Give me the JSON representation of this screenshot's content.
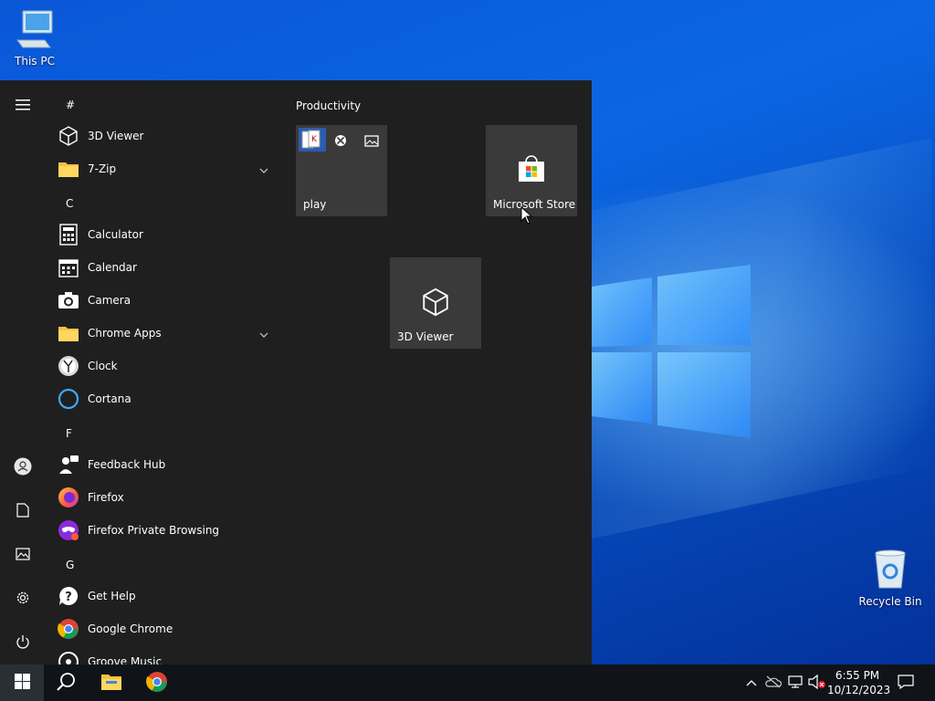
{
  "desktop": {
    "icons": [
      {
        "label": "This PC",
        "icon": "computer-icon"
      },
      {
        "label": "Recycle Bin",
        "icon": "recycle-bin-icon"
      }
    ]
  },
  "start_menu": {
    "rail": [
      "hamburger-menu-icon",
      "user-icon",
      "documents-icon",
      "pictures-icon",
      "settings-icon",
      "power-icon"
    ],
    "sections": [
      {
        "letter": "#",
        "apps": [
          {
            "label": "3D Viewer",
            "icon": "cube-icon"
          },
          {
            "label": "7-Zip",
            "icon": "folder-icon",
            "expandable": true
          }
        ]
      },
      {
        "letter": "C",
        "apps": [
          {
            "label": "Calculator",
            "icon": "calculator-icon"
          },
          {
            "label": "Calendar",
            "icon": "calendar-icon"
          },
          {
            "label": "Camera",
            "icon": "camera-icon"
          },
          {
            "label": "Chrome Apps",
            "icon": "folder-icon",
            "expandable": true
          },
          {
            "label": "Clock",
            "icon": "clock-icon"
          },
          {
            "label": "Cortana",
            "icon": "cortana-icon"
          }
        ]
      },
      {
        "letter": "F",
        "apps": [
          {
            "label": "Feedback Hub",
            "icon": "feedback-icon"
          },
          {
            "label": "Firefox",
            "icon": "firefox-icon"
          },
          {
            "label": "Firefox Private Browsing",
            "icon": "firefox-private-icon"
          }
        ]
      },
      {
        "letter": "G",
        "apps": [
          {
            "label": "Get Help",
            "icon": "help-icon"
          },
          {
            "label": "Google Chrome",
            "icon": "chrome-icon"
          },
          {
            "label": "Groove Music",
            "icon": "music-icon"
          }
        ]
      }
    ],
    "tiles": {
      "group_title": "Productivity",
      "play_label": "play",
      "store_label": "Microsoft Store",
      "viewer_label": "3D Viewer"
    }
  },
  "taskbar": {
    "start": "windows-start-icon",
    "search": "search-icon",
    "pinned": [
      "file-explorer-icon",
      "chrome-icon"
    ],
    "tray": [
      "chevron-up-icon",
      "onedrive-icon",
      "network-icon",
      "volume-muted-icon"
    ],
    "time": "6:55 PM",
    "date": "10/12/2023",
    "notification": "action-center-icon"
  }
}
